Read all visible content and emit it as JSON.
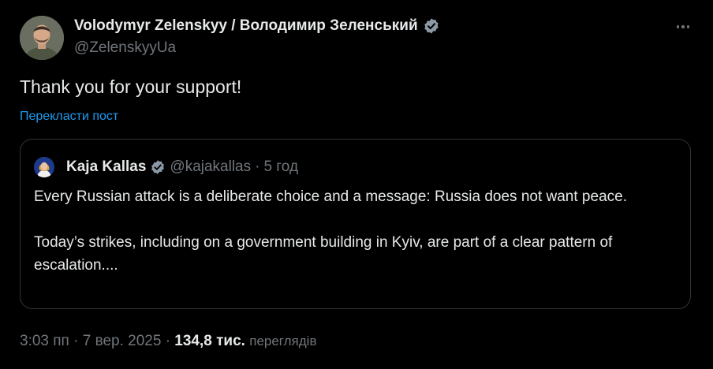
{
  "post": {
    "author_name": "Volodymyr Zelenskyy / Володимир Зеленський",
    "author_handle": "@ZelenskyyUa",
    "verified_icon": "verified-badge-icon",
    "more_icon": "more-horizontal-icon",
    "text": "Thank you for your support!",
    "translate_label": "Перекласти пост"
  },
  "quote": {
    "author_name": "Kaja Kallas",
    "author_handle": "@kajakallas",
    "separator": "·",
    "time": "5 год",
    "paragraph_1": "Every Russian attack is a deliberate choice and a message: Russia does not want peace.",
    "paragraph_2": "Today’s strikes, including on a government building in Kyiv, are part of a clear pattern of escalation...."
  },
  "footer": {
    "timestamp": "3:03 пп · 7 вер. 2025",
    "separator": "·",
    "views_count": "134,8 тис.",
    "views_label": "переглядів"
  },
  "colors": {
    "background": "#000000",
    "text_primary": "#e7e9ea",
    "text_secondary": "#71767b",
    "accent": "#1d9bf0",
    "border": "#2f3336",
    "verified_badge": "#8b98a5"
  }
}
